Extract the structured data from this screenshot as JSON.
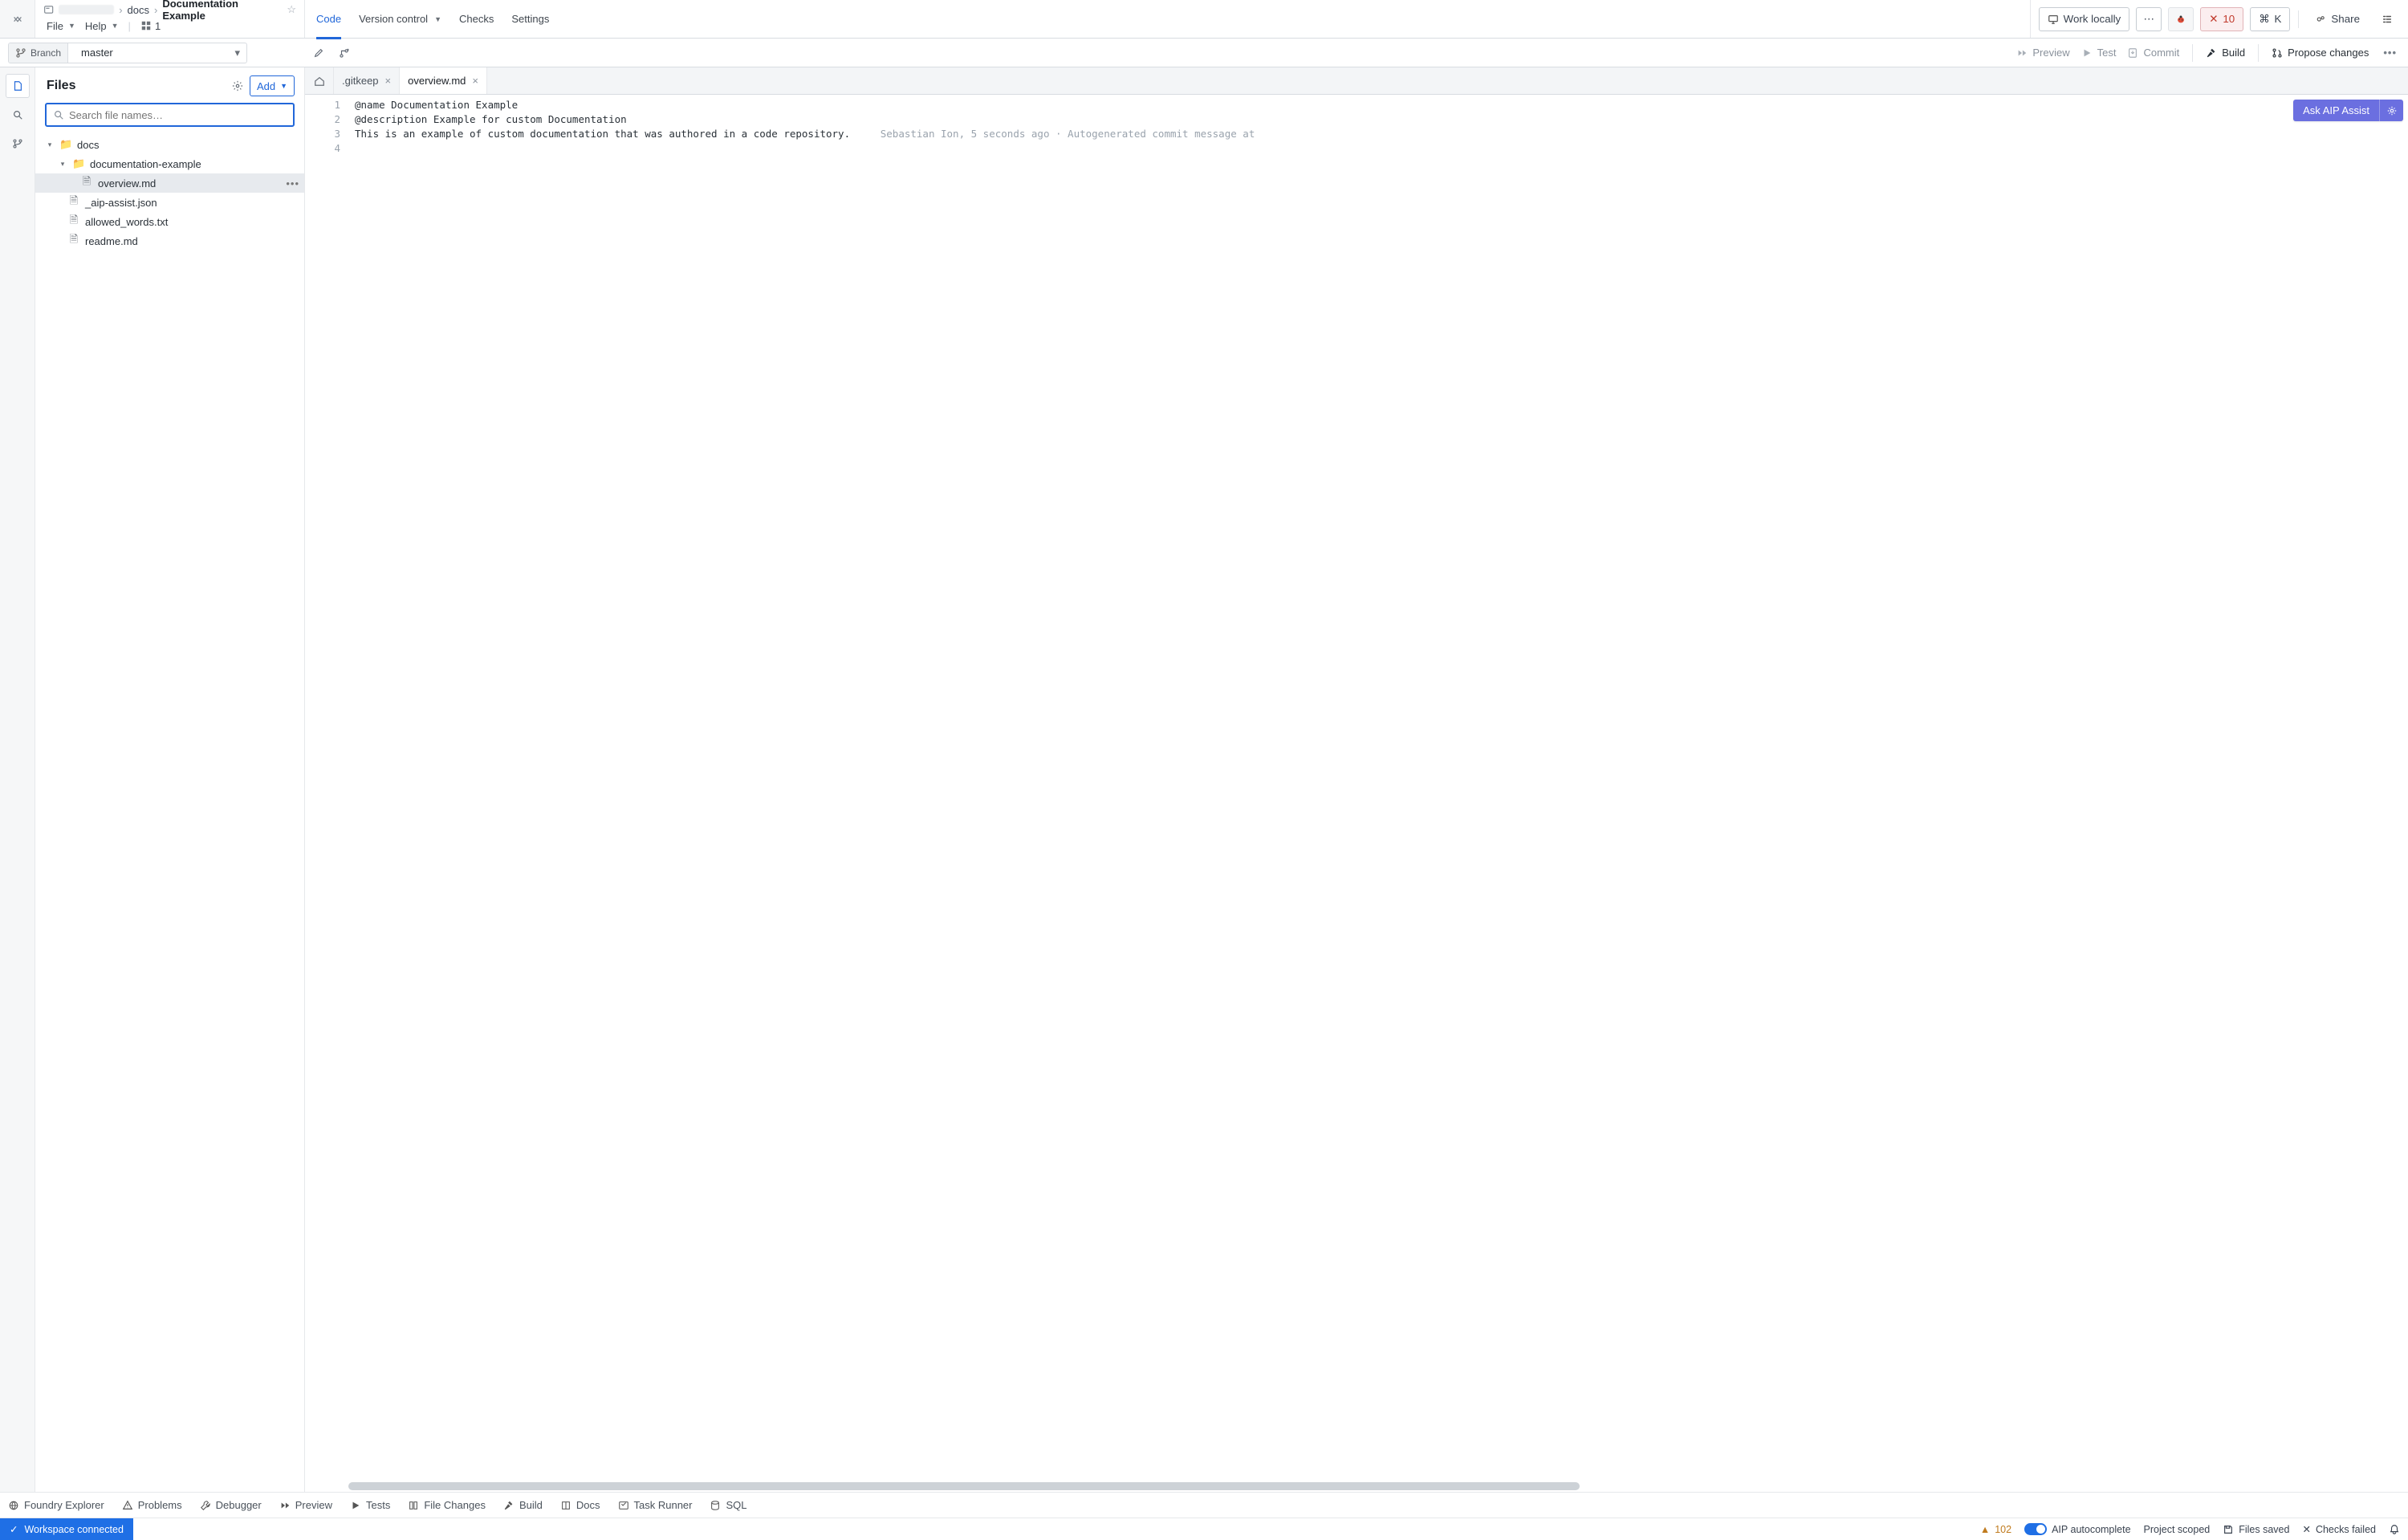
{
  "breadcrumb": {
    "path1": "docs",
    "title": "Documentation Example"
  },
  "menus": {
    "file": "File",
    "help": "Help",
    "workspaces": "1"
  },
  "top_tabs": {
    "code": "Code",
    "version_control": "Version control",
    "checks": "Checks",
    "settings": "Settings"
  },
  "top_right": {
    "work_locally": "Work locally",
    "error_count": "10",
    "cmd_k": "K",
    "share": "Share"
  },
  "branch": {
    "label": "Branch",
    "name": "master"
  },
  "right_actions": {
    "preview": "Preview",
    "test": "Test",
    "commit": "Commit",
    "build": "Build",
    "propose": "Propose changes"
  },
  "sidebar": {
    "title": "Files",
    "add": "Add",
    "search_placeholder": "Search file names…",
    "tree": {
      "root": "docs",
      "folder": "documentation-example",
      "file_selected": "overview.md",
      "file_aip": "_aip-assist.json",
      "file_allowed": "allowed_words.txt",
      "file_readme": "readme.md"
    }
  },
  "editor_tabs": {
    "gitkeep": ".gitkeep",
    "overview": "overview.md"
  },
  "editor": {
    "line1": "@name Documentation Example",
    "line2": "@description Example for custom Documentation",
    "line3": "",
    "line4_code": "This is an example of custom documentation that was authored in a code repository.",
    "line4_annot": "Sebastian Ion, 5 seconds ago · Autogenerated commit message at",
    "ln1": "1",
    "ln2": "2",
    "ln3": "3",
    "ln4": "4",
    "aip_button": "Ask AIP Assist"
  },
  "bottom_panels": {
    "explorer": "Foundry Explorer",
    "problems": "Problems",
    "debugger": "Debugger",
    "preview": "Preview",
    "tests": "Tests",
    "file_changes": "File Changes",
    "build": "Build",
    "docs": "Docs",
    "task_runner": "Task Runner",
    "sql": "SQL"
  },
  "statusbar": {
    "workspace": "Workspace connected",
    "warn_count": "102",
    "autocomplete": "AIP autocomplete",
    "scope": "Project scoped",
    "saved": "Files saved",
    "checks_failed": "Checks failed"
  }
}
